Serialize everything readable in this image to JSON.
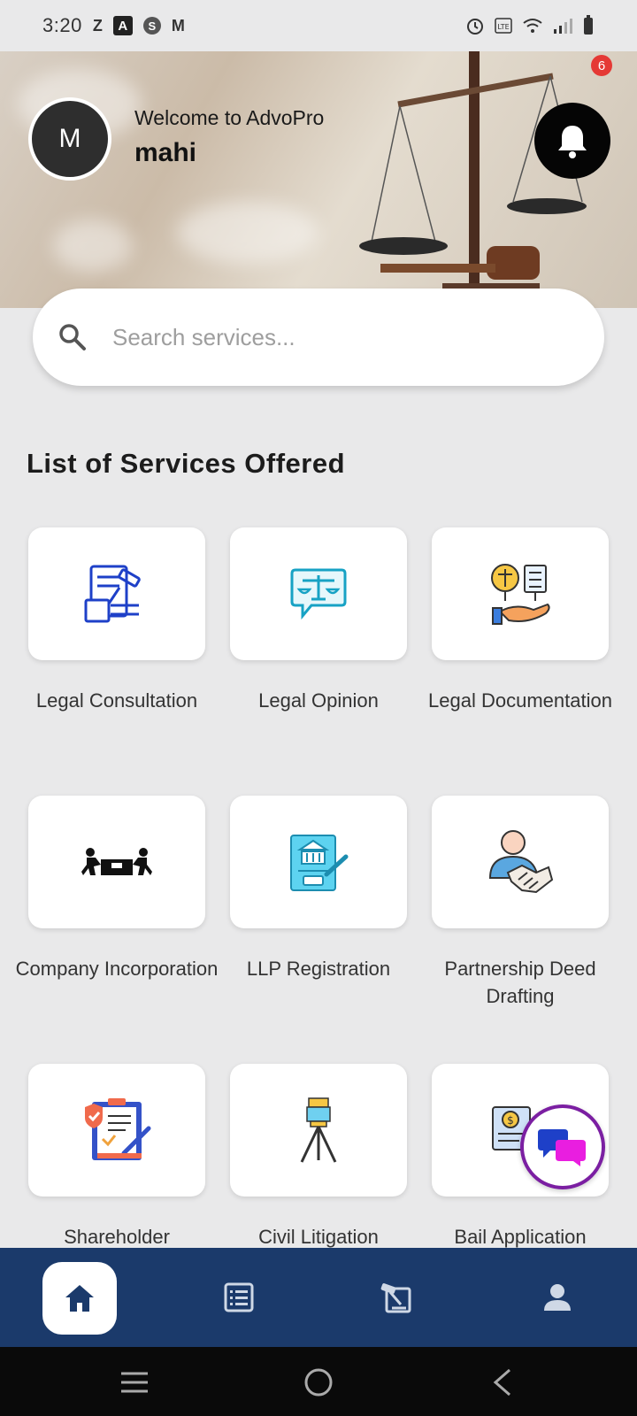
{
  "status_bar": {
    "time": "3:20",
    "left_icons": [
      "Z",
      "A",
      "S",
      "M"
    ]
  },
  "header": {
    "avatar_initial": "M",
    "welcome_text": "Welcome to AdvoPro",
    "username": "mahi",
    "notification_count": "6"
  },
  "search": {
    "placeholder": "Search services..."
  },
  "section_title": "List of Services Offered",
  "services": [
    {
      "label": "Legal Consultation",
      "icon": "legal-consultation-icon"
    },
    {
      "label": "Legal Opinion",
      "icon": "legal-opinion-icon"
    },
    {
      "label": "Legal Documentation",
      "icon": "legal-documentation-icon"
    },
    {
      "label": "Company Incorporation",
      "icon": "company-incorporation-icon"
    },
    {
      "label": "LLP Registration",
      "icon": "llp-registration-icon"
    },
    {
      "label": "Partnership Deed Drafting",
      "icon": "partnership-deed-icon"
    },
    {
      "label": "Shareholder",
      "icon": "shareholder-icon"
    },
    {
      "label": "Civil Litigation",
      "icon": "civil-litigation-icon"
    },
    {
      "label": "Bail Application",
      "icon": "bail-application-icon"
    }
  ],
  "colors": {
    "nav_bg": "#1b3a6b",
    "accent_purple": "#7b1fa2",
    "badge_red": "#e53935"
  }
}
